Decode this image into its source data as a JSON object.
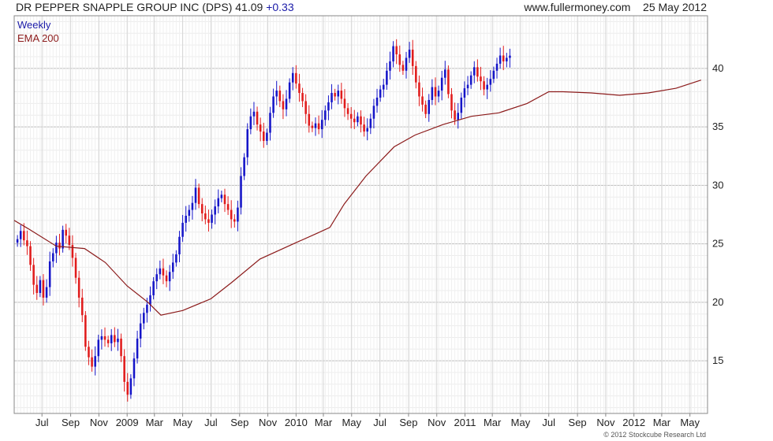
{
  "header": {
    "symbol_title": "DR PEPPER SNAPPLE GROUP INC (DPS)",
    "last_price": "41.09",
    "change": "+0.33",
    "site": "www.fullermoney.com",
    "date": "25 May 2012"
  },
  "footer": {
    "copyright": "© 2012 Stockcube Research Ltd"
  },
  "colors": {
    "up": "#1515c8",
    "down": "#e01b1b",
    "ema": "#8b1a1a",
    "grid": "#d9d9d9",
    "legend_weekly": "#1a1aa8",
    "legend_ema": "#8b1a1a",
    "change": "#1a1aa8"
  },
  "chart_data": {
    "type": "candlestick",
    "title": "DR PEPPER SNAPPLE GROUP INC (DPS)",
    "legend": [
      "Weekly",
      "EMA 200"
    ],
    "legend_position": "top-left",
    "grid": true,
    "ylim": [
      10.5,
      44.5
    ],
    "yticks": [
      15,
      20,
      25,
      30,
      35,
      40
    ],
    "x_range": [
      "2008-05-02",
      "2012-06-08"
    ],
    "xticks": [
      {
        "date": "2008-07-01",
        "label": "Jul"
      },
      {
        "date": "2008-09-01",
        "label": "Sep"
      },
      {
        "date": "2008-11-01",
        "label": "Nov"
      },
      {
        "date": "2009-01-01",
        "label": "2009"
      },
      {
        "date": "2009-03-01",
        "label": "Mar"
      },
      {
        "date": "2009-05-01",
        "label": "May"
      },
      {
        "date": "2009-07-01",
        "label": "Jul"
      },
      {
        "date": "2009-09-01",
        "label": "Sep"
      },
      {
        "date": "2009-11-01",
        "label": "Nov"
      },
      {
        "date": "2010-01-01",
        "label": "2010"
      },
      {
        "date": "2010-03-01",
        "label": "Mar"
      },
      {
        "date": "2010-05-01",
        "label": "May"
      },
      {
        "date": "2010-07-01",
        "label": "Jul"
      },
      {
        "date": "2010-09-01",
        "label": "Sep"
      },
      {
        "date": "2010-11-01",
        "label": "Nov"
      },
      {
        "date": "2011-01-01",
        "label": "2011"
      },
      {
        "date": "2011-03-01",
        "label": "Mar"
      },
      {
        "date": "2011-05-01",
        "label": "May"
      },
      {
        "date": "2011-07-01",
        "label": "Jul"
      },
      {
        "date": "2011-09-01",
        "label": "Sep"
      },
      {
        "date": "2011-11-01",
        "label": "Nov"
      },
      {
        "date": "2012-01-01",
        "label": "2012"
      },
      {
        "date": "2012-03-01",
        "label": "Mar"
      },
      {
        "date": "2012-05-01",
        "label": "May"
      }
    ],
    "ohlc_series": {
      "name": "Weekly",
      "start_date": "2008-05-09",
      "interval_days": 7,
      "close_values": [
        25.4,
        26.1,
        25.3,
        24.8,
        23.2,
        21.5,
        20.8,
        21.9,
        20.4,
        21.3,
        23.5,
        24.2,
        25.1,
        24.6,
        26.2,
        25.7,
        24.9,
        23.8,
        22.1,
        20.4,
        18.9,
        16.2,
        15.3,
        14.5,
        15.4,
        16.8,
        17.1,
        16.8,
        16.5,
        17.2,
        16.6,
        16.9,
        15.4,
        13.2,
        12.1,
        13.5,
        15.2,
        16.9,
        18.2,
        19.1,
        19.8,
        20.6,
        21.8,
        22.4,
        22.9,
        22.3,
        21.8,
        22.6,
        23.4,
        24.1,
        25.6,
        26.8,
        27.4,
        27.9,
        28.5,
        29.8,
        28.4,
        27.6,
        27.1,
        26.8,
        27.5,
        28.2,
        28.9,
        29.2,
        28.4,
        27.9,
        27.1,
        26.9,
        28.1,
        30.8,
        32.4,
        34.8,
        35.9,
        36.3,
        35.2,
        34.6,
        33.8,
        34.5,
        36.2,
        37.6,
        38.1,
        37.2,
        36.5,
        37.4,
        38.8,
        39.6,
        38.7,
        37.9,
        37.2,
        36.1,
        35.1,
        34.9,
        35.3,
        34.8,
        35.6,
        36.4,
        37.1,
        37.9,
        37.6,
        38.1,
        37.4,
        36.6,
        36.1,
        35.7,
        35.4,
        35.9,
        35.2,
        34.6,
        34.9,
        35.7,
        36.8,
        37.5,
        38.2,
        38.6,
        39.8,
        40.6,
        41.9,
        41.2,
        40.3,
        39.8,
        40.9,
        41.6,
        40.2,
        38.8,
        37.6,
        36.9,
        36.1,
        37.3,
        38.4,
        37.6,
        38.1,
        39.2,
        39.9,
        37.8,
        36.4,
        35.6,
        36.2,
        37.5,
        38.3,
        38.6,
        39.4,
        40.1,
        39.3,
        38.9,
        38.2,
        38.6,
        39.1,
        39.8,
        40.4,
        41.1,
        40.6,
        40.9,
        41.09
      ]
    },
    "ema_series": {
      "name": "EMA 200",
      "points": [
        {
          "date": "2008-05-02",
          "value": 27.0
        },
        {
          "date": "2008-06-01",
          "value": 26.3
        },
        {
          "date": "2008-08-01",
          "value": 24.8
        },
        {
          "date": "2008-10-01",
          "value": 24.6
        },
        {
          "date": "2008-11-15",
          "value": 23.4
        },
        {
          "date": "2009-01-01",
          "value": 21.4
        },
        {
          "date": "2009-02-15",
          "value": 20.0
        },
        {
          "date": "2009-03-15",
          "value": 18.9
        },
        {
          "date": "2009-05-01",
          "value": 19.3
        },
        {
          "date": "2009-07-01",
          "value": 20.3
        },
        {
          "date": "2009-08-15",
          "value": 21.7
        },
        {
          "date": "2009-10-15",
          "value": 23.7
        },
        {
          "date": "2010-01-01",
          "value": 25.1
        },
        {
          "date": "2010-02-15",
          "value": 25.9
        },
        {
          "date": "2010-03-15",
          "value": 26.4
        },
        {
          "date": "2010-04-15",
          "value": 28.4
        },
        {
          "date": "2010-06-01",
          "value": 30.8
        },
        {
          "date": "2010-08-01",
          "value": 33.3
        },
        {
          "date": "2010-09-15",
          "value": 34.3
        },
        {
          "date": "2010-11-15",
          "value": 35.2
        },
        {
          "date": "2011-01-15",
          "value": 35.9
        },
        {
          "date": "2011-03-15",
          "value": 36.2
        },
        {
          "date": "2011-05-15",
          "value": 37.0
        },
        {
          "date": "2011-07-01",
          "value": 38.0
        },
        {
          "date": "2011-08-01",
          "value": 38.0
        },
        {
          "date": "2011-10-01",
          "value": 37.9
        },
        {
          "date": "2011-12-01",
          "value": 37.7
        },
        {
          "date": "2012-02-01",
          "value": 37.9
        },
        {
          "date": "2012-04-01",
          "value": 38.3
        },
        {
          "date": "2012-05-25",
          "value": 39.0
        }
      ]
    }
  }
}
